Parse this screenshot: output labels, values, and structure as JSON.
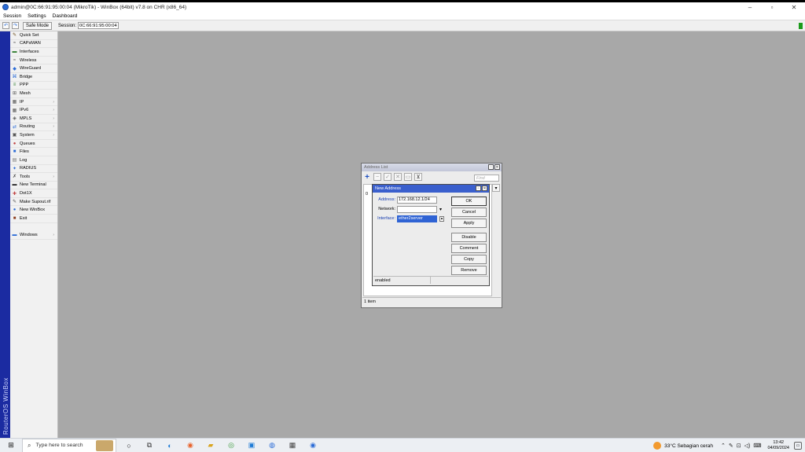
{
  "window": {
    "title": "admin@0C:66:91:95:00:04 (MikroTik) - WinBox (64bit) v7.8 on CHR (x86_64)",
    "controls": {
      "minimize": "–",
      "maximize": "▫",
      "close": "✕"
    }
  },
  "menubar": {
    "items": [
      "Session",
      "Settings",
      "Dashboard"
    ]
  },
  "toolbar": {
    "undo_icon": "↶",
    "redo_icon": "↷",
    "safe_mode_label": "Safe Mode",
    "session_label": "Session:",
    "session_value": "0C:66:91:95:00:04",
    "indicator_color": "#1b9b1b"
  },
  "vertical_brand": "RouterOS WinBox",
  "sidebar": {
    "items": [
      {
        "label": "Quick Set",
        "icon": "✎",
        "color": "#6b4d1a",
        "arrow": ""
      },
      {
        "label": "CAPsMAN",
        "icon": "≈",
        "color": "#555",
        "arrow": ""
      },
      {
        "label": "Interfaces",
        "icon": "▬",
        "color": "#2a7a2a",
        "arrow": ""
      },
      {
        "label": "Wireless",
        "icon": "≈",
        "color": "#555",
        "arrow": ""
      },
      {
        "label": "WireGuard",
        "icon": "◆",
        "color": "#2a6bd6",
        "arrow": ""
      },
      {
        "label": "Bridge",
        "icon": "⌘",
        "color": "#2a6bd6",
        "arrow": ""
      },
      {
        "label": "PPP",
        "icon": "≡",
        "color": "#2a7a2a",
        "arrow": ""
      },
      {
        "label": "Mesh",
        "icon": "⊞",
        "color": "#555",
        "arrow": ""
      },
      {
        "label": "IP",
        "icon": "▦",
        "color": "#555",
        "arrow": "›"
      },
      {
        "label": "IPv6",
        "icon": "▦",
        "color": "#555",
        "arrow": "›"
      },
      {
        "label": "MPLS",
        "icon": "◈",
        "color": "#555",
        "arrow": "›"
      },
      {
        "label": "Routing",
        "icon": "⇄",
        "color": "#2a6bd6",
        "arrow": "›"
      },
      {
        "label": "System",
        "icon": "▣",
        "color": "#555",
        "arrow": "›"
      },
      {
        "label": "Queues",
        "icon": "●",
        "color": "#c04040",
        "arrow": ""
      },
      {
        "label": "Files",
        "icon": "■",
        "color": "#2a6bd6",
        "arrow": ""
      },
      {
        "label": "Log",
        "icon": "▤",
        "color": "#777",
        "arrow": ""
      },
      {
        "label": "RADIUS",
        "icon": "✦",
        "color": "#2a6bd6",
        "arrow": ""
      },
      {
        "label": "Tools",
        "icon": "✗",
        "color": "#444",
        "arrow": "›"
      },
      {
        "label": "New Terminal",
        "icon": "▬",
        "color": "#222",
        "arrow": ""
      },
      {
        "label": "Dot1X",
        "icon": "✚",
        "color": "#c04040",
        "arrow": ""
      },
      {
        "label": "Make Supout.rif",
        "icon": "✎",
        "color": "#555",
        "arrow": ""
      },
      {
        "label": "New WinBox",
        "icon": "●",
        "color": "#2a6bd6",
        "arrow": ""
      },
      {
        "label": "Exit",
        "icon": "■",
        "color": "#8a3a1a",
        "arrow": ""
      }
    ],
    "windows_item": {
      "label": "Windows",
      "icon": "▬",
      "color": "#2a6bd6",
      "arrow": "›"
    }
  },
  "address_list": {
    "title": "Address List",
    "find_placeholder": "Find",
    "row_number": "0",
    "status": "1 item",
    "tools": [
      "+",
      "−",
      "✓",
      "✕",
      "▭",
      "⊻"
    ]
  },
  "new_address": {
    "title": "New Address",
    "fields": {
      "address_label": "Address:",
      "address_value": "172.168.12.1/24",
      "network_label": "Network:",
      "network_value": "",
      "interface_label": "Interface:",
      "interface_value": "ether2server"
    },
    "buttons": [
      "OK",
      "Cancel",
      "Apply",
      "Disable",
      "Comment",
      "Copy",
      "Remove"
    ],
    "status": "enabled"
  },
  "taskbar": {
    "search_placeholder": "Type here to search",
    "apps": [
      "○",
      "⧉",
      "◐",
      "◉",
      "▰",
      "◎",
      "▣",
      "◍",
      "▦",
      "◉"
    ],
    "weather": "33°C  Sebagian cerah",
    "tray_icons": [
      "⌃",
      "✎",
      "⊡",
      "◁)",
      "⌨"
    ],
    "time": "13:42",
    "date": "04/09/2024"
  }
}
